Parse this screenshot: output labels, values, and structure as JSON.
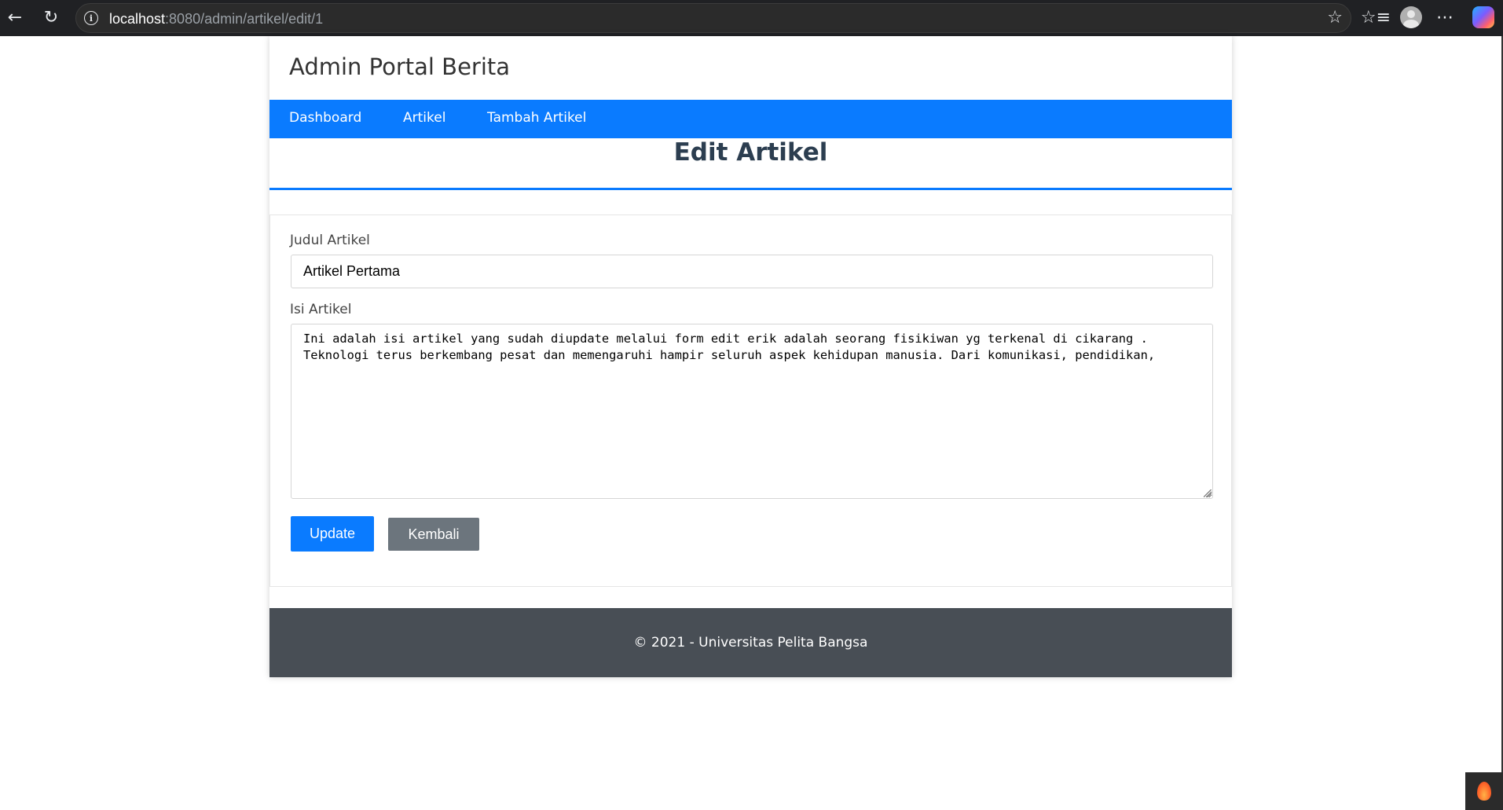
{
  "browser": {
    "url_host": "localhost",
    "url_path": ":8080/admin/artikel/edit/1"
  },
  "site": {
    "title": "Admin Portal Berita"
  },
  "nav": {
    "items": [
      {
        "label": "Dashboard"
      },
      {
        "label": "Artikel"
      },
      {
        "label": "Tambah Artikel"
      }
    ]
  },
  "page": {
    "heading": "Edit Artikel"
  },
  "form": {
    "title_label": "Judul Artikel",
    "title_value": "Artikel Pertama",
    "content_label": "Isi Artikel",
    "content_value": "Ini adalah isi artikel yang sudah diupdate melalui form edit erik adalah seorang fisikiwan yg terkenal di cikarang .\nTeknologi terus berkembang pesat dan memengaruhi hampir seluruh aspek kehidupan manusia. Dari komunikasi, pendidikan,",
    "update_label": "Update",
    "back_label": "Kembali"
  },
  "footer": {
    "text": "© 2021 - Universitas Pelita Bangsa"
  },
  "colors": {
    "primary": "#0a7bff",
    "secondary": "#6c757d",
    "footer_bg": "#484e55",
    "heading_text": "#2c3e50"
  },
  "icons": [
    "back-arrow-icon",
    "reload-icon",
    "info-icon",
    "favorite-star-icon",
    "favorites-list-icon",
    "profile-avatar-icon",
    "more-menu-icon",
    "copilot-icon",
    "flame-icon"
  ]
}
